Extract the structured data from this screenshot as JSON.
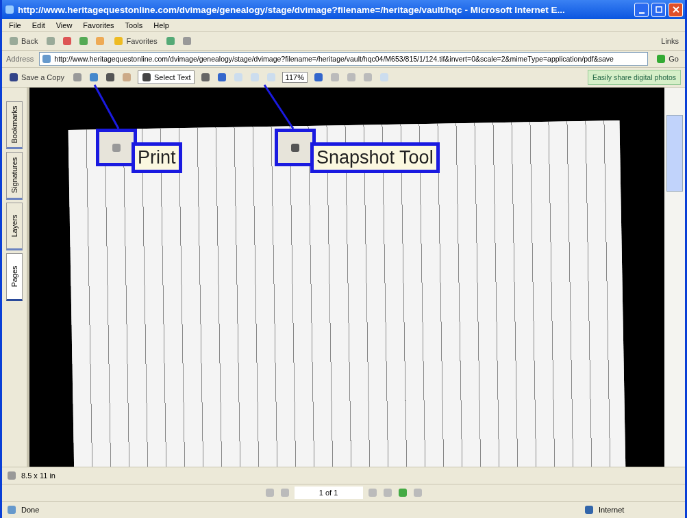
{
  "window": {
    "title": "http://www.heritagequestonline.com/dvimage/genealogy/stage/dvimage?filename=/heritage/vault/hqc - Microsoft Internet E..."
  },
  "menu": [
    "File",
    "Edit",
    "View",
    "Favorites",
    "Tools",
    "Help"
  ],
  "nav_toolbar": {
    "back": "Back",
    "favorites": "Favorites",
    "links": "Links"
  },
  "address": {
    "label": "Address",
    "value": "http://www.heritagequestonline.com/dvimage/genealogy/stage/dvimage?filename=/heritage/vault/hqc04/M653/815/1/124.tif&invert=0&scale=2&mimeType=application/pdf&save",
    "go": "Go"
  },
  "pdf_toolbar": {
    "save": "Save a Copy",
    "select_text": "Select Text",
    "zoom": "117%",
    "promo": "Easily share digital photos"
  },
  "side_tabs": [
    {
      "label": "Bookmarks",
      "selected": false
    },
    {
      "label": "Signatures",
      "selected": false
    },
    {
      "label": "Layers",
      "selected": false
    },
    {
      "label": "Pages",
      "selected": true
    }
  ],
  "callouts": [
    {
      "kind": "print",
      "label": "Print"
    },
    {
      "kind": "snapshot",
      "label": "Snapshot Tool"
    }
  ],
  "page_size": "8.5 x 11 in",
  "page_nav": {
    "page": "1 of 1"
  },
  "status_bar": {
    "text": "Done",
    "zone": "Internet"
  }
}
